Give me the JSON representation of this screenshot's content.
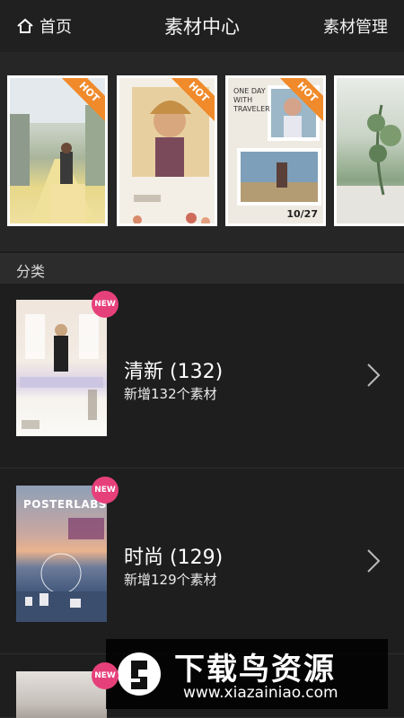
{
  "header": {
    "home_label": "首页",
    "title": "素材中心",
    "manage_label": "素材管理"
  },
  "carousel": {
    "cards": [
      {
        "badge": "HOT"
      },
      {
        "badge": "HOT"
      },
      {
        "badge": "HOT",
        "caption_lines": [
          "ONE DAY",
          "WITH",
          "TRAVELER"
        ],
        "date": "10/27"
      },
      {
        "badge": ""
      }
    ]
  },
  "section": {
    "label": "分类"
  },
  "categories": [
    {
      "badge": "NEW",
      "name": "清新 (132)",
      "sub": "新增132个素材"
    },
    {
      "badge": "NEW",
      "name": "时尚 (129)",
      "sub": "新增129个素材",
      "poster_title": "POSTERLABS"
    },
    {
      "badge": "NEW"
    }
  ],
  "watermark": {
    "text": "下载鸟资源",
    "url": "www.xiazainiao.com"
  },
  "colors": {
    "hot_ribbon": "#f08a2a",
    "new_badge": "#e6407a",
    "background": "#1e1e1e"
  }
}
